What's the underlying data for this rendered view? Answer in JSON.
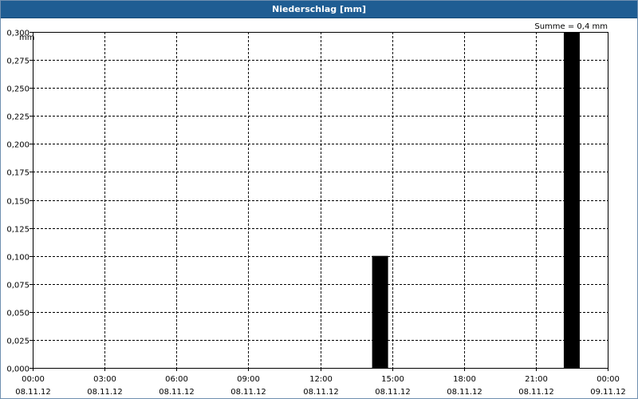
{
  "chart_data": {
    "type": "bar",
    "title": "Niederschlag [mm]",
    "ylabel": "mm",
    "annotation": "Summe = 0,4 mm",
    "ylim": [
      0,
      0.3
    ],
    "y_ticks": [
      "0,000",
      "0,025",
      "0,050",
      "0,075",
      "0,100",
      "0,125",
      "0,150",
      "0,175",
      "0,200",
      "0,225",
      "0,250",
      "0,275",
      "0,300"
    ],
    "x_ticks": [
      {
        "time": "00:00",
        "date": "08.11.12"
      },
      {
        "time": "03:00",
        "date": "08.11.12"
      },
      {
        "time": "06:00",
        "date": "08.11.12"
      },
      {
        "time": "09:00",
        "date": "08.11.12"
      },
      {
        "time": "12:00",
        "date": "08.11.12"
      },
      {
        "time": "15:00",
        "date": "08.11.12"
      },
      {
        "time": "18:00",
        "date": "08.11.12"
      },
      {
        "time": "21:00",
        "date": "08.11.12"
      },
      {
        "time": "00:00",
        "date": "09.11.12"
      }
    ],
    "x_range": [
      "08.11.12 00:00",
      "09.11.12 00:00"
    ],
    "grid": true,
    "bars": [
      {
        "x": "08.11.12 14:30",
        "y": 0.1
      },
      {
        "x": "08.11.12 22:30",
        "y": 0.3
      }
    ],
    "colors": {
      "bar": "#000000",
      "title_bar": "#1f5d93",
      "grid": "#000000"
    }
  }
}
